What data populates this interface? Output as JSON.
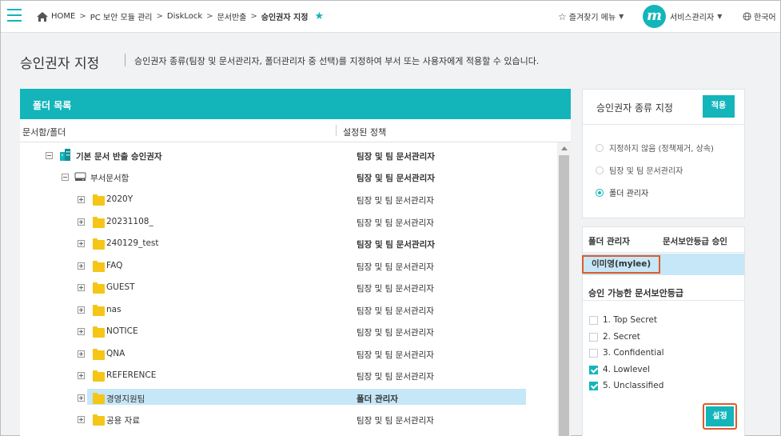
{
  "breadcrumb": [
    "HOME",
    "PC 보안 모듈 관리",
    "DiskLock",
    "문서반출",
    "승인권자 지정"
  ],
  "header": {
    "fav_menu": "즐겨찾기 메뉴",
    "logo_letter": "m",
    "user": "서비스관리자",
    "language": "한국어"
  },
  "page": {
    "title": "승인권자 지정",
    "description": "승인권자 종류(팀장 및 문서관리자, 폴더관리자 중 선택)를 지정하여 부서 또는 사용자에게 적용할 수 있습니다."
  },
  "folder_panel": {
    "title": "폴더 목록",
    "col_folder": "문서함/폴더",
    "col_policy": "설정된 정책",
    "rows": [
      {
        "name": "기본 문서 반출 승인권자",
        "policy": "팀장 및 팀 문서관리자",
        "expand": "minus",
        "icon": "building-icon"
      },
      {
        "name": "부서문서함",
        "policy": "팀장 및 팀 문서관리자",
        "expand": "minus",
        "icon": "drive-icon"
      },
      {
        "name": "2020Y",
        "policy": "팀장 및 팀 문서관리자",
        "expand": "plus",
        "icon": "folder-icon"
      },
      {
        "name": "20231108_",
        "policy": "팀장 및 팀 문서관리자",
        "expand": "plus",
        "icon": "folder-icon"
      },
      {
        "name": "240129_test",
        "policy": "팀장 및 팀 문서관리자",
        "expand": "plus",
        "icon": "folder-icon"
      },
      {
        "name": "FAQ",
        "policy": "팀장 및 팀 문서관리자",
        "expand": "plus",
        "icon": "folder-icon"
      },
      {
        "name": "GUEST",
        "policy": "팀장 및 팀 문서관리자",
        "expand": "plus",
        "icon": "folder-icon"
      },
      {
        "name": "nas",
        "policy": "팀장 및 팀 문서관리자",
        "expand": "plus",
        "icon": "folder-icon"
      },
      {
        "name": "NOTICE",
        "policy": "팀장 및 팀 문서관리자",
        "expand": "plus",
        "icon": "folder-icon"
      },
      {
        "name": "QNA",
        "policy": "팀장 및 팀 문서관리자",
        "expand": "plus",
        "icon": "folder-icon"
      },
      {
        "name": "REFERENCE",
        "policy": "팀장 및 팀 문서관리자",
        "expand": "plus",
        "icon": "folder-icon"
      },
      {
        "name": "경영지원팀",
        "policy": "폴더 관리자",
        "expand": "plus",
        "icon": "folder-icon",
        "selected": true
      },
      {
        "name": "공용 자료",
        "policy": "팀장 및 팀 문서관리자",
        "expand": "plus",
        "icon": "folder-icon"
      }
    ]
  },
  "kind_panel": {
    "title": "승인권자 종류 지정",
    "apply_label": "적용",
    "options": [
      {
        "label": "지정하지 않음 (정책제거, 상속)",
        "checked": false
      },
      {
        "label": "팀장 및 팀 문서관리자",
        "checked": false
      },
      {
        "label": "폴더 관리자",
        "checked": true
      }
    ]
  },
  "admin_panel": {
    "col_admin": "폴더 관리자",
    "col_grade": "문서보안등급 승인",
    "admin_name": "이미영(mylee)",
    "grade_title": "승인 가능한 문서보안등급",
    "grades": [
      {
        "label": "1. Top Secret",
        "checked": false
      },
      {
        "label": "2. Secret",
        "checked": false
      },
      {
        "label": "3. Confidential",
        "checked": false
      },
      {
        "label": "4. Lowlevel",
        "checked": true
      },
      {
        "label": "5. Unclassified",
        "checked": true
      }
    ],
    "set_label": "설정"
  },
  "colors": {
    "accent": "#13b5bb",
    "highlight": "#c6e7f7",
    "callout": "#e05a2b"
  }
}
